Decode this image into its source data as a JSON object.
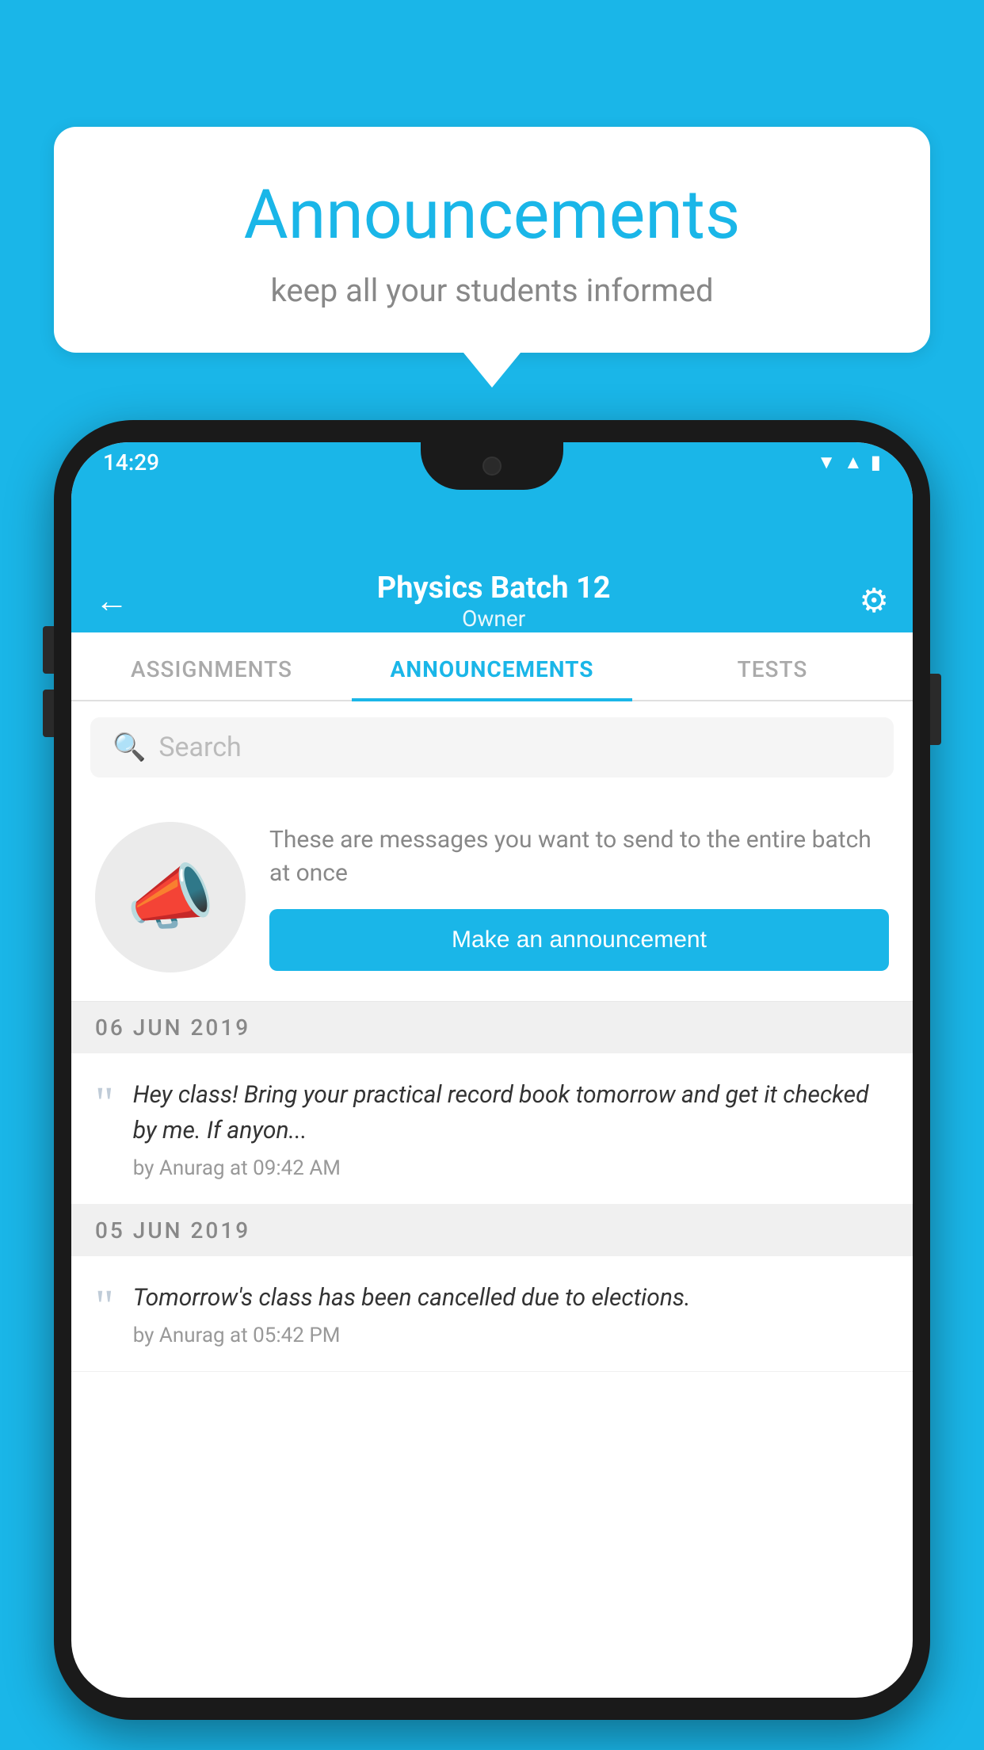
{
  "background_color": "#1ab6e8",
  "speech_bubble": {
    "title": "Announcements",
    "subtitle": "keep all your students informed"
  },
  "phone": {
    "status_bar": {
      "time": "14:29",
      "icons": [
        "wifi",
        "signal",
        "battery"
      ]
    },
    "app_bar": {
      "title": "Physics Batch 12",
      "subtitle": "Owner",
      "back_label": "←",
      "settings_label": "⚙"
    },
    "tabs": [
      {
        "label": "ASSIGNMENTS",
        "active": false
      },
      {
        "label": "ANNOUNCEMENTS",
        "active": true
      },
      {
        "label": "TESTS",
        "active": false
      },
      {
        "label": "...",
        "active": false
      }
    ],
    "search": {
      "placeholder": "Search"
    },
    "announcement_cta": {
      "description": "These are messages you want to send to the entire batch at once",
      "button_label": "Make an announcement"
    },
    "announcements": [
      {
        "date": "06  JUN  2019",
        "text": "Hey class! Bring your practical record book tomorrow and get it checked by me. If anyon...",
        "meta": "by Anurag at 09:42 AM"
      },
      {
        "date": "05  JUN  2019",
        "text": "Tomorrow's class has been cancelled due to elections.",
        "meta": "by Anurag at 05:42 PM"
      }
    ]
  }
}
